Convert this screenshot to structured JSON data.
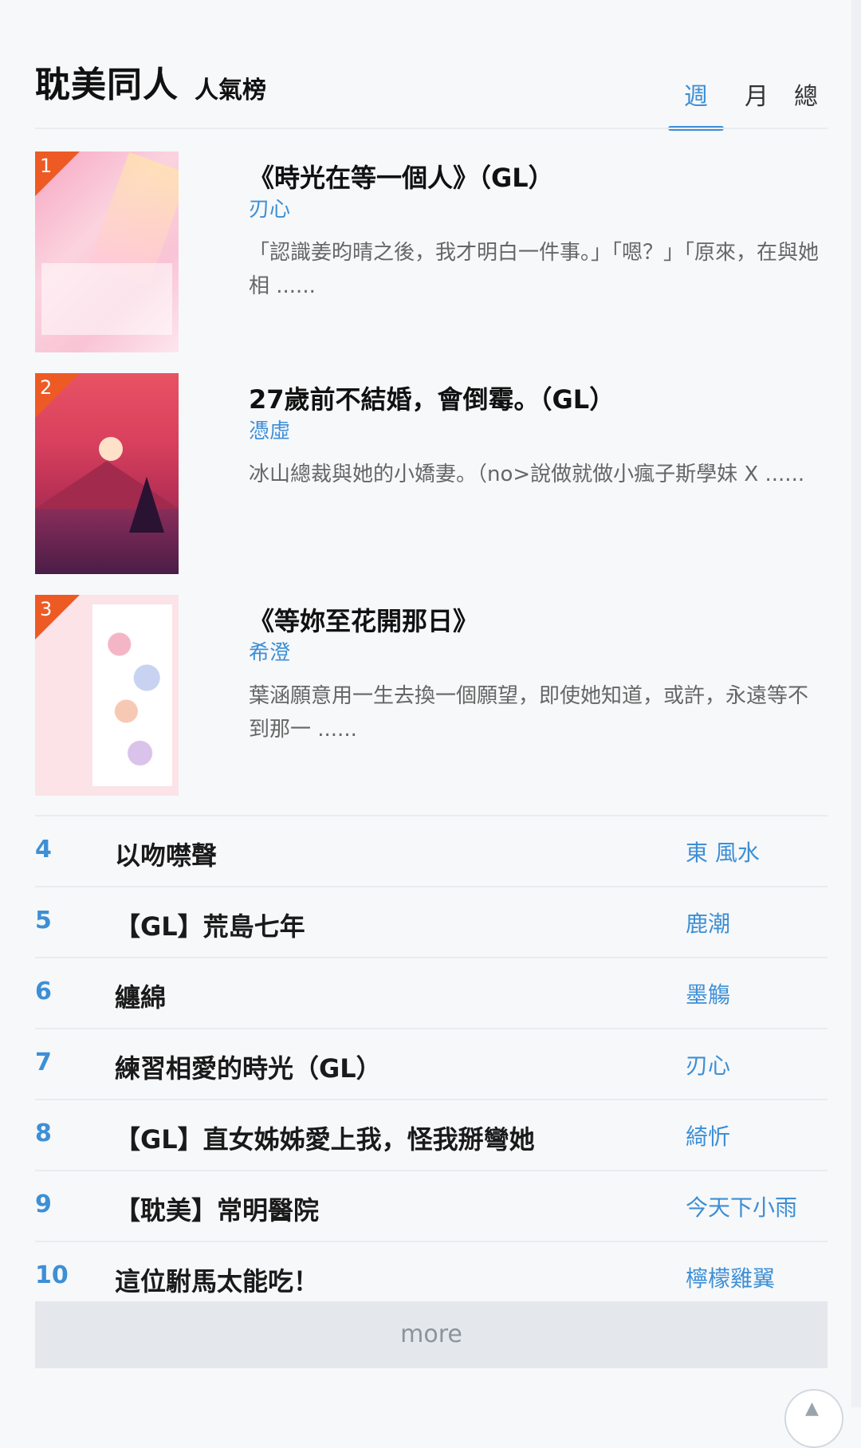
{
  "header": {
    "title": "耽美同人",
    "subtitle": "人氣榜",
    "tabs": {
      "week": "週",
      "month": "月",
      "total": "總"
    },
    "active_tab": "週"
  },
  "top_books": [
    {
      "rank": "1",
      "title": "《時光在等一個人》（GL）",
      "author": "刃心",
      "description": "「認識姜昀晴之後，我才明白一件事。」「嗯？」「原來，在與她相 ......"
    },
    {
      "rank": "2",
      "title": "27歲前不結婚，會倒霉。（GL）",
      "author": "憑虛",
      "description": "冰山總裁與她的小嬌妻。（no>說做就做小瘋子斯學妹 X ......"
    },
    {
      "rank": "3",
      "title": "《等妳至花開那日》",
      "author": "希澄",
      "description": "葉涵願意用一生去換一個願望，即使她知道，或許，永遠等不到那一 ......"
    }
  ],
  "list": [
    {
      "rank": "4",
      "title": "以吻噤聲",
      "author": "東 風水"
    },
    {
      "rank": "5",
      "title": "【GL】荒島七年",
      "author": "鹿潮"
    },
    {
      "rank": "6",
      "title": "纏綿",
      "author": "墨觴"
    },
    {
      "rank": "7",
      "title": "練習相愛的時光（GL）",
      "author": "刃心"
    },
    {
      "rank": "8",
      "title": "【GL】直女姊姊愛上我，怪我掰彎她",
      "author": "綺忻"
    },
    {
      "rank": "9",
      "title": "【耽美】常明醫院",
      "author": "今天下小雨"
    },
    {
      "rank": "10",
      "title": "這位駙馬太能吃！",
      "author": "檸檬雞翼"
    }
  ],
  "more_label": "more",
  "colors": {
    "accent": "#3d8fd6",
    "rank_flag": "#ee5a24"
  },
  "icons": {
    "scroll_top": "chevron-up-icon"
  }
}
